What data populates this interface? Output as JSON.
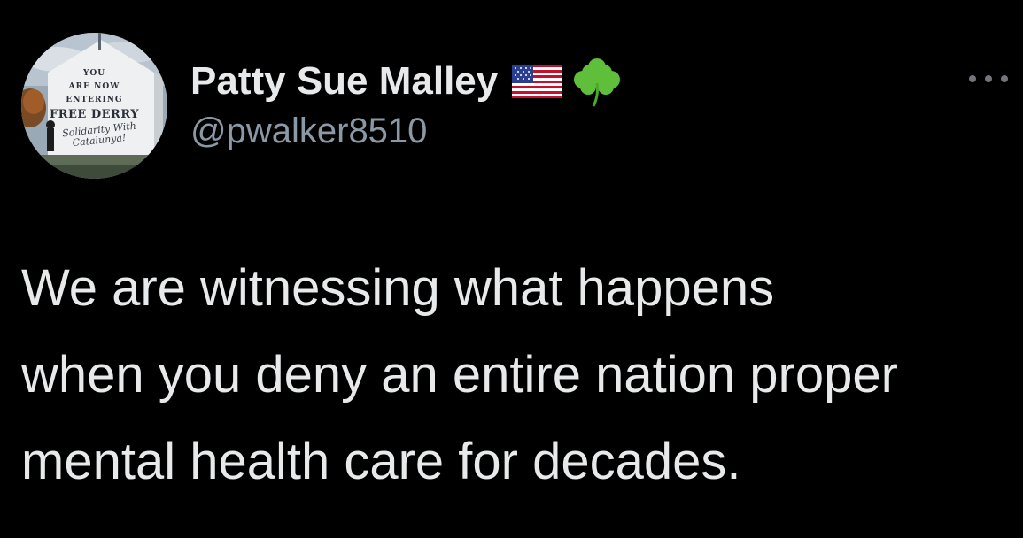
{
  "author": {
    "display_name": "Patty Sue Malley",
    "handle": "@pwalker8510",
    "avatar": {
      "description_icon": "free-derry-mural-avatar",
      "mural_lines": [
        "YOU",
        "ARE NOW",
        "ENTERING",
        "FREE DERRY"
      ],
      "mural_script_lines": [
        "Solidarity With",
        "Catalunya!"
      ]
    },
    "name_emoji": [
      "us-flag-icon",
      "shamrock-icon"
    ]
  },
  "actions": {
    "more_icon": "more-horizontal-icon"
  },
  "tweet": {
    "lines": [
      "We are witnessing what happens",
      "when you deny an entire nation proper",
      "mental health care for decades."
    ]
  },
  "colors": {
    "background": "#000000",
    "primary_text": "#e7e9ea",
    "secondary_text": "#8b98a5",
    "icon_gray": "#71767b"
  }
}
